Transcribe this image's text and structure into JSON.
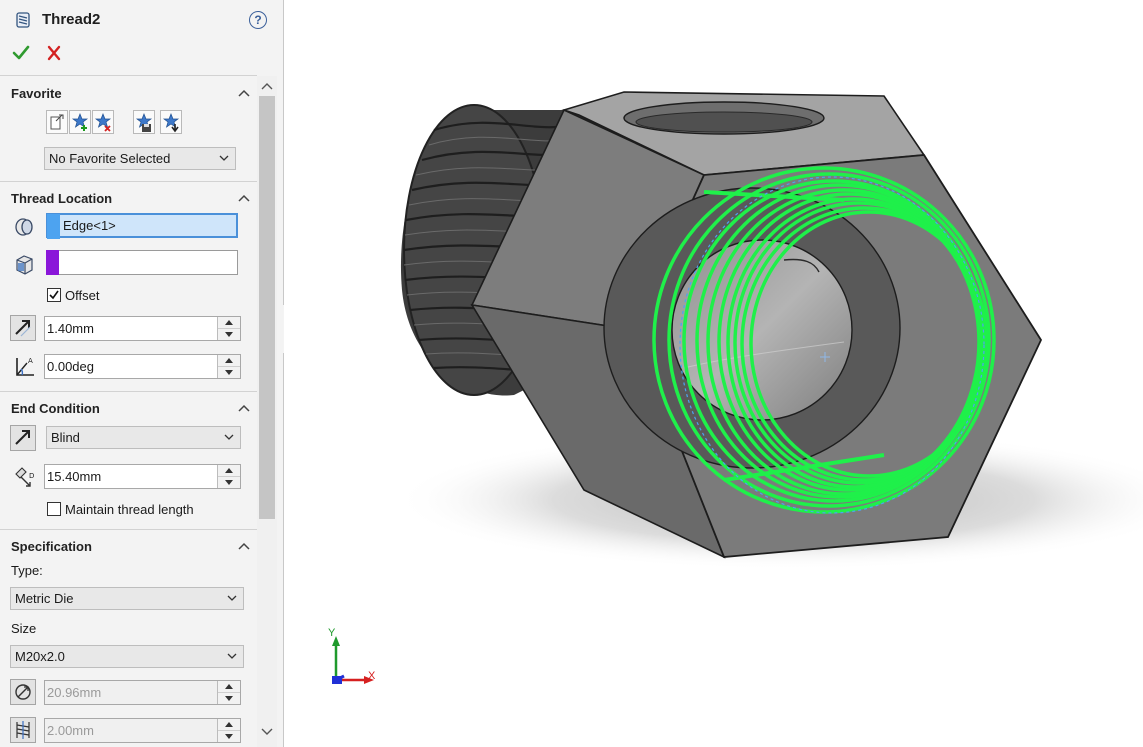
{
  "feature": {
    "title": "Thread2",
    "help_icon": "help-icon",
    "help_glyph": "?"
  },
  "actions": {
    "ok_icon": "checkmark-icon",
    "cancel_icon": "x-icon",
    "ok_color": "#2f9a2f",
    "cancel_color": "#d32222"
  },
  "favorite": {
    "heading": "Favorite",
    "toolbar_icons": [
      "apply-defaults-icon",
      "add-favorite-icon",
      "delete-favorite-icon",
      "save-favorite-icon",
      "load-favorite-icon"
    ],
    "selected": "No Favorite Selected"
  },
  "thread_location": {
    "heading": "Thread Location",
    "edge_value": "Edge<1>",
    "edge_color": "#4da3f0",
    "face_value": "",
    "face_color": "#8a16d9",
    "offset_label": "Offset",
    "offset_checked": true,
    "offset_distance": "1.40mm",
    "start_angle": "0.00deg"
  },
  "end_condition": {
    "heading": "End Condition",
    "type": "Blind",
    "depth": "15.40mm",
    "maintain_label": "Maintain thread length",
    "maintain_checked": false
  },
  "specification": {
    "heading": "Specification",
    "type_label": "Type:",
    "type_value": "Metric Die",
    "size_label": "Size",
    "size_value": "M20x2.0",
    "diameter": "20.96mm",
    "pitch": "2.00mm"
  },
  "viewport": {
    "thread_color": "#1ff04a",
    "axis_x": "X",
    "axis_y": "Y",
    "axis_x_color": "#d62020",
    "axis_y_color": "#1f9a2c"
  }
}
